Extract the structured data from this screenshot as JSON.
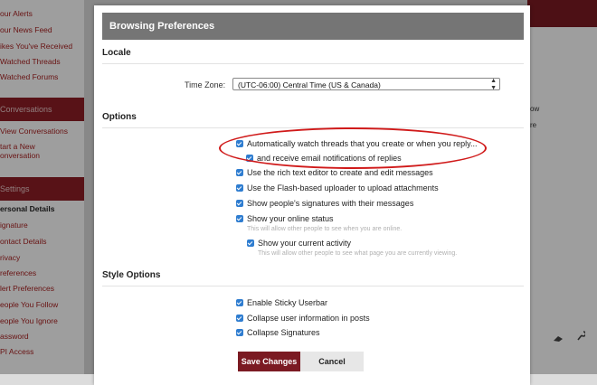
{
  "background": {
    "nav_top": [
      "our Alerts",
      "our News Feed",
      "ikes You've Received",
      "Watched Threads",
      "Watched Forums"
    ],
    "conversations_header": "Conversations",
    "conversations": [
      "View Conversations",
      "tart a New",
      "onversation"
    ],
    "settings_header": "Settings",
    "settings_items": [
      "ersonal Details",
      "ignature",
      "ontact Details",
      "rivacy",
      "references",
      "lert Preferences",
      "eople You Follow",
      "eople You Ignore",
      "assword",
      "PI Access"
    ],
    "right_fragments": [
      "ow",
      "re"
    ],
    "right_icons": [
      "eraser-icon",
      "wrench-icon"
    ]
  },
  "modal": {
    "title": "Browsing Preferences",
    "locale_header": "Locale",
    "timezone_label": "Time Zone:",
    "timezone_value": "(UTC-06:00) Central Time (US & Canada)",
    "options_header": "Options",
    "options": [
      {
        "label": "Automatically watch threads that you create or when you reply...",
        "checked": true
      },
      {
        "label": "and receive email notifications of replies",
        "checked": true
      },
      {
        "label": "Use the rich text editor to create and edit messages",
        "checked": true
      },
      {
        "label": "Use the Flash-based uploader to upload attachments",
        "checked": true
      },
      {
        "label": "Show people's signatures with their messages",
        "checked": true
      },
      {
        "label": "Show your online status",
        "checked": true
      },
      {
        "label": "Show your current activity",
        "checked": true
      }
    ],
    "hint_online": "This will allow other people to see when you are online.",
    "hint_activity": "This will allow other people to see what page you are currently viewing.",
    "style_header": "Style Options",
    "style_options": [
      {
        "label": "Enable Sticky Userbar",
        "checked": true
      },
      {
        "label": "Collapse user information in posts",
        "checked": true
      },
      {
        "label": "Collapse Signatures",
        "checked": true
      }
    ],
    "save_label": "Save Changes",
    "cancel_label": "Cancel",
    "accent_color": "#7b1a22",
    "checkbox_color": "#2f7dd0",
    "annotation_color": "#d01a1a"
  }
}
